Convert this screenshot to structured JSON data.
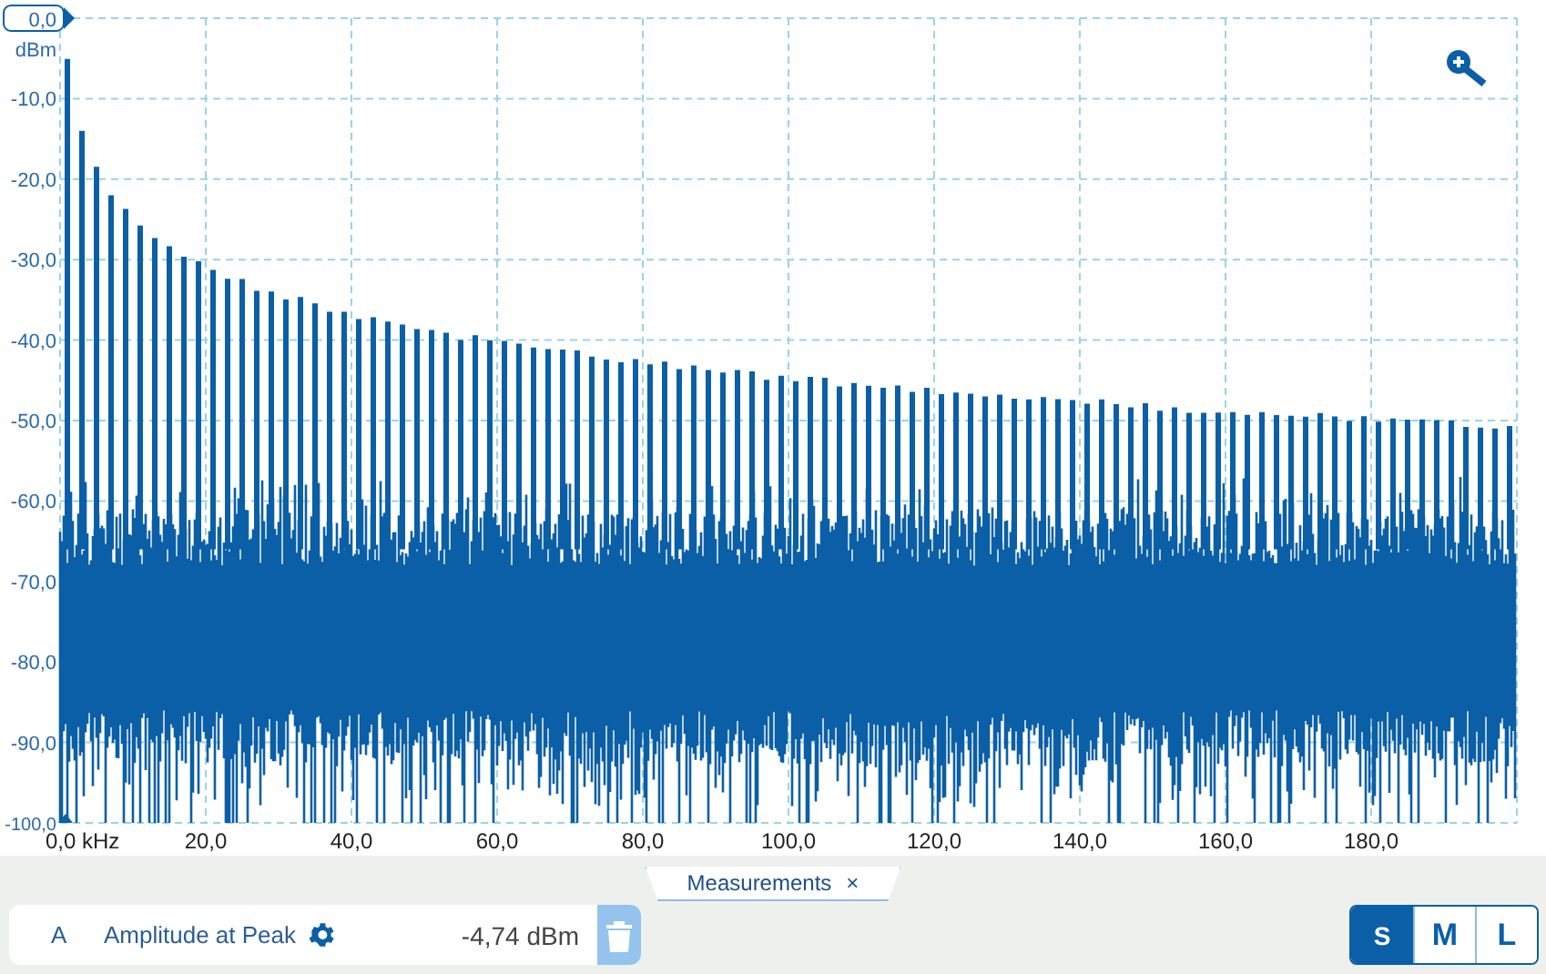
{
  "y_axis": {
    "top_marker": "0,0",
    "unit": "dBm",
    "ticks": [
      "-10,0",
      "-20,0",
      "-30,0",
      "-40,0",
      "-50,0",
      "-60,0",
      "-70,0",
      "-80,0",
      "-90,0",
      "-100,0"
    ]
  },
  "x_axis": {
    "ticks": [
      "0,0 kHz",
      "20,0",
      "40,0",
      "60,0",
      "80,0",
      "100,0",
      "120,0",
      "140,0",
      "160,0",
      "180,0"
    ]
  },
  "measurements_tab": {
    "label": "Measurements",
    "close": "×"
  },
  "measurements": [
    {
      "channel": "A",
      "name": "Amplitude at Peak",
      "value": "-4,74 dBm"
    }
  ],
  "size_buttons": [
    {
      "label": "S",
      "selected": true
    },
    {
      "label": "M",
      "selected": false
    },
    {
      "label": "L",
      "selected": false
    }
  ]
}
